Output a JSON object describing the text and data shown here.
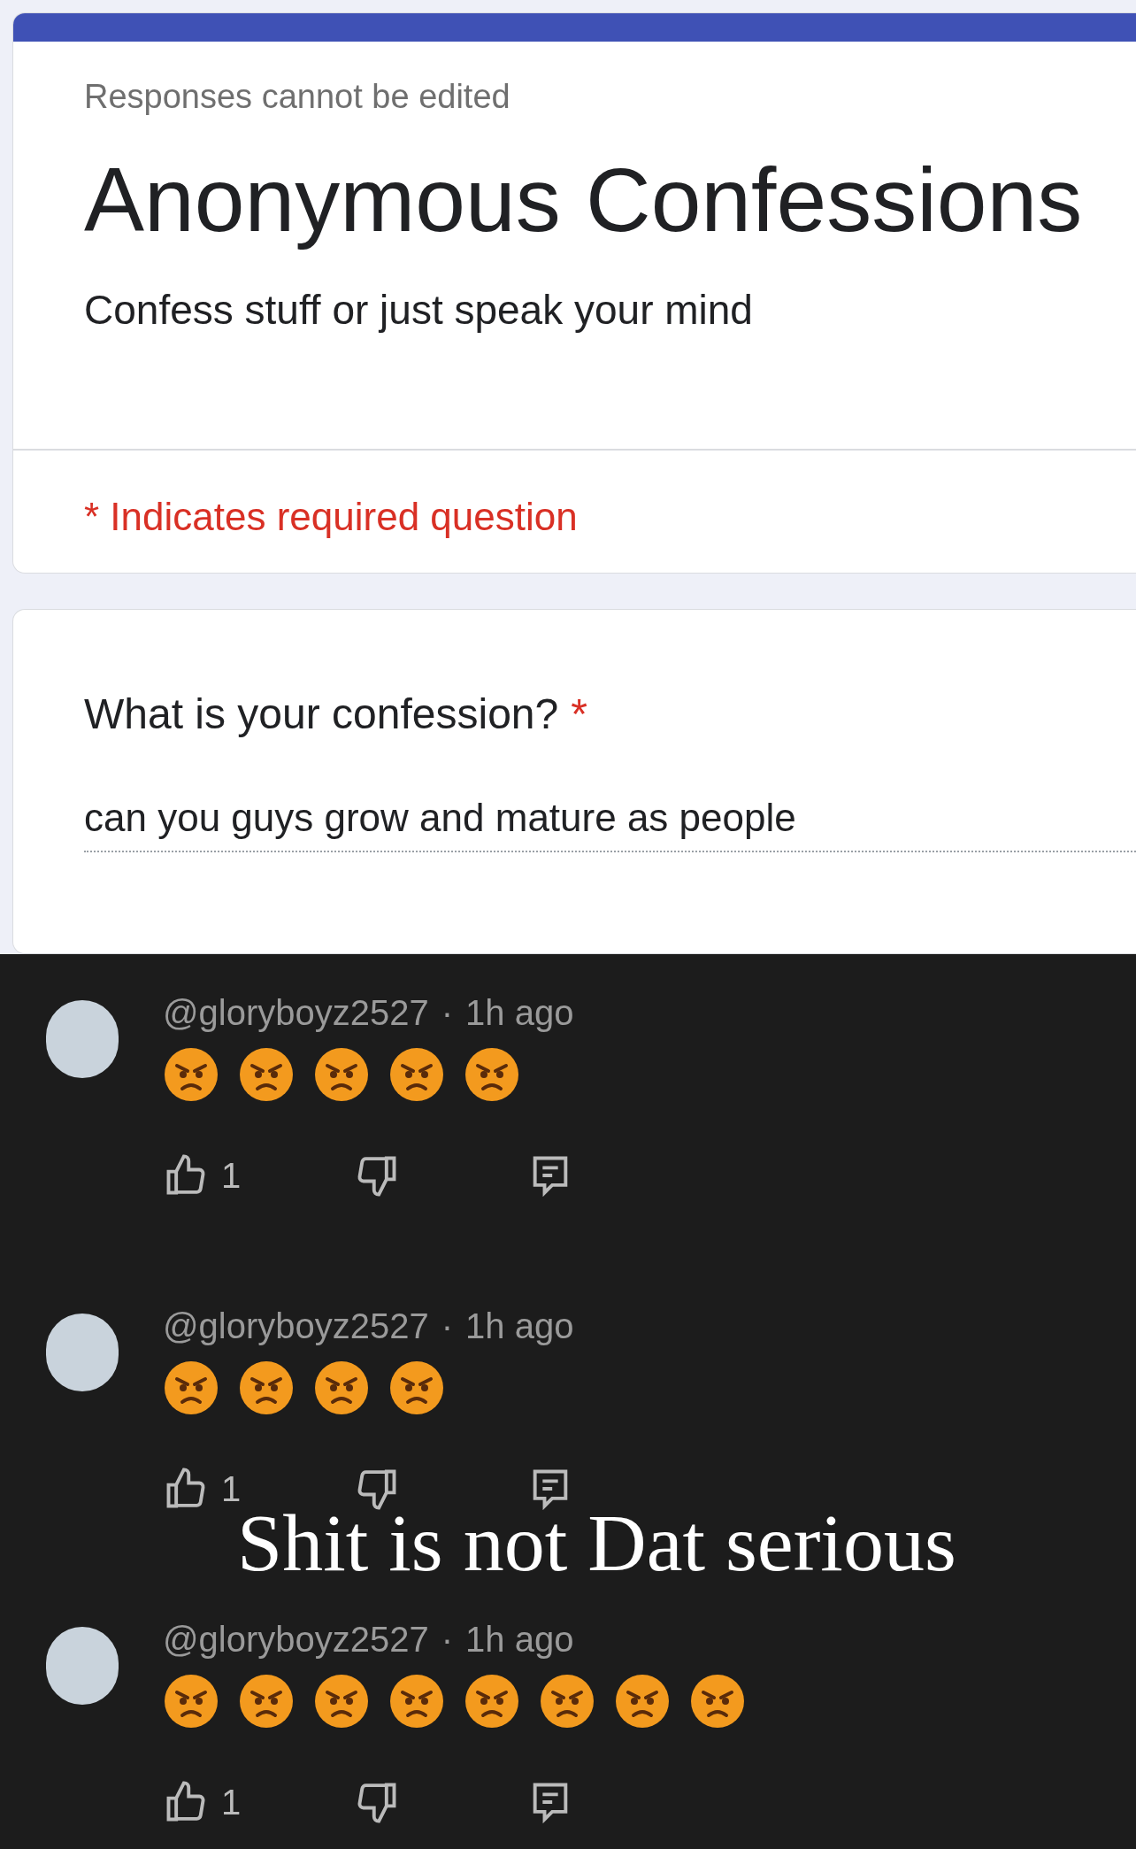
{
  "form": {
    "notice": "Responses cannot be edited",
    "title": "Anonymous Confessions",
    "description": "Confess stuff or just speak your mind",
    "required_note": "* Indicates required question",
    "question": {
      "label": "What is your confession?",
      "required_mark": "*",
      "answer": "can you guys grow and mature as people"
    }
  },
  "comments": [
    {
      "author": "@gloryboyz2527",
      "separator": "·",
      "time": "1h ago",
      "emojis": [
        {
          "kind": "angry"
        },
        {
          "kind": "angry"
        },
        {
          "kind": "angry"
        },
        {
          "kind": "angry"
        },
        {
          "kind": "angry"
        }
      ],
      "likes": "1"
    },
    {
      "author": "@gloryboyz2527",
      "separator": "·",
      "time": "1h ago",
      "emojis": [
        {
          "kind": "angry"
        },
        {
          "kind": "angry"
        },
        {
          "kind": "angry"
        },
        {
          "kind": "angry"
        }
      ],
      "likes": "1"
    },
    {
      "author": "@gloryboyz2527",
      "separator": "·",
      "time": "1h ago",
      "emojis": [
        {
          "kind": "angry"
        },
        {
          "kind": "angry"
        },
        {
          "kind": "angry"
        },
        {
          "kind": "angry"
        },
        {
          "kind": "angry"
        },
        {
          "kind": "angry"
        },
        {
          "kind": "angry"
        },
        {
          "kind": "angry"
        }
      ],
      "likes": "1"
    }
  ],
  "caption": "Shit is not Dat serious"
}
